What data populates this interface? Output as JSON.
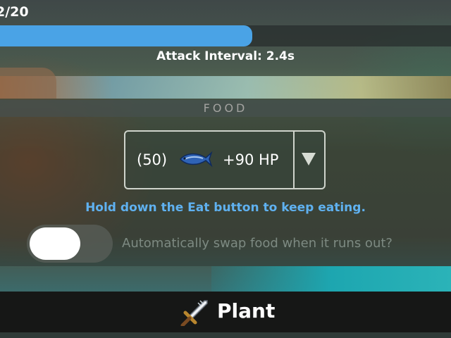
{
  "status": {
    "hp_text": "2/20",
    "hp_fraction": 0.56,
    "attack_interval": "Attack Interval: 2.4s"
  },
  "food": {
    "header": "FOOD",
    "selected": {
      "count": "(50)",
      "icon": "fish-icon",
      "heal": "+90 HP"
    },
    "hint": "Hold down the Eat button to keep eating.",
    "auto_swap_label": "Automatically swap food when it runs out?",
    "auto_swap_enabled": false
  },
  "bottom_bar": {
    "label": "Plant",
    "icon": "sword-icon"
  },
  "colors": {
    "bar_fill": "#4aa3e6",
    "hint_text": "#5fb1f0",
    "bottom_bar_bg": "#161716"
  }
}
